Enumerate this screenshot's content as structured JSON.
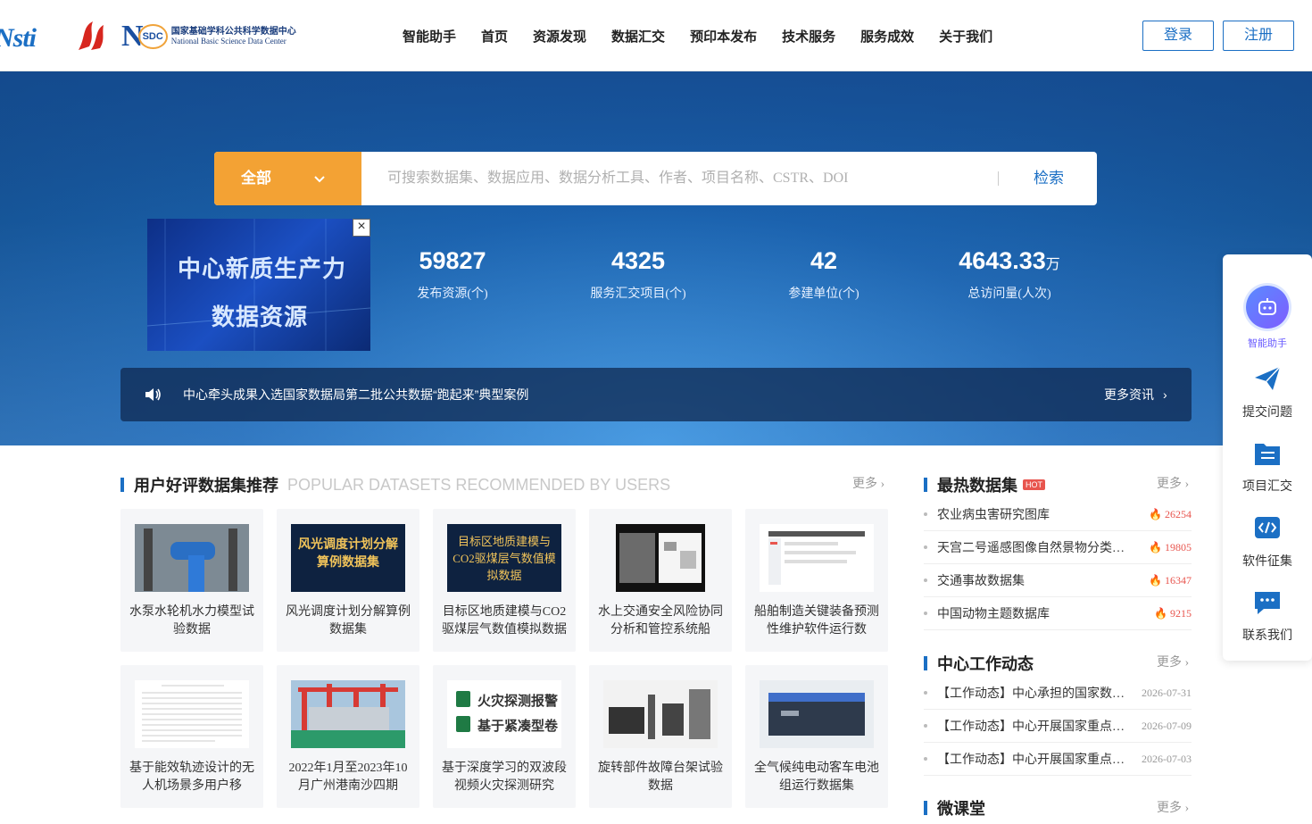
{
  "header": {
    "logo_nsti": "Nsti",
    "logo_n": "N",
    "logo_sdc": "SDC",
    "logo_cn": "国家基础学科公共科学数据中心",
    "logo_en": "National Basic Science Data Center",
    "nav": [
      "智能助手",
      "首页",
      "资源发现",
      "数据汇交",
      "预印本发布",
      "技术服务",
      "服务成效",
      "关于我们"
    ],
    "login": "登录",
    "register": "注册"
  },
  "search": {
    "category": "全部",
    "placeholder": "可搜索数据集、数据应用、数据分析工具、作者、项目名称、CSTR、DOI",
    "button": "检索"
  },
  "promo": {
    "line1": "中心新质生产力",
    "line2": "数据资源",
    "close": "×"
  },
  "stats": [
    {
      "num": "59827",
      "unit": "",
      "label": "发布资源(个)"
    },
    {
      "num": "4325",
      "unit": "",
      "label": "服务汇交项目(个)"
    },
    {
      "num": "42",
      "unit": "",
      "label": "参建单位(个)"
    },
    {
      "num": "4643.33",
      "unit": "万",
      "label": "总访问量(人次)"
    }
  ],
  "notice": {
    "message": "中心牵头成果入选国家数据局第二批公共数据“跑起来”典型案例",
    "more": "更多资讯"
  },
  "sidebar": {
    "ai": "智能助手",
    "items": [
      "提交问题",
      "项目汇交",
      "软件征集",
      "联系我们"
    ]
  },
  "datasets": {
    "title": "用户好评数据集推荐",
    "subtitle": "POPULAR DATASETS RECOMMENDED BY USERS",
    "more": "更多",
    "cards": [
      {
        "caption": "水泵水轮机水力模型试验数据",
        "thumb_text": ""
      },
      {
        "caption": "风光调度计划分解算例数据集",
        "thumb_text": "风光调度计划分解算例数据集"
      },
      {
        "caption": "目标区地质建模与CO2驱煤层气数值模拟数据",
        "thumb_text": "目标区地质建模与CO2驱煤层气数值模拟数据"
      },
      {
        "caption": "水上交通安全风险协同分析和管控系统船",
        "thumb_text": ""
      },
      {
        "caption": "船舶制造关键装备预测性维护软件运行数",
        "thumb_text": ""
      },
      {
        "caption": "基于能效轨迹设计的无人机场景多用户移",
        "thumb_text": ""
      },
      {
        "caption": "2022年1月至2023年10月广州港南沙四期",
        "thumb_text": ""
      },
      {
        "caption": "基于深度学习的双波段视频火灾探测研究",
        "thumb_text": "火灾探测报警 基于紧凑型卷"
      },
      {
        "caption": "旋转部件故障台架试验数据",
        "thumb_text": ""
      },
      {
        "caption": "全气候纯电动客车电池组运行数据集",
        "thumb_text": ""
      }
    ]
  },
  "hottest": {
    "title": "最热数据集",
    "badge": "HOT",
    "more": "更多",
    "rows": [
      {
        "title": "农业病虫害研究图库",
        "count": "26254"
      },
      {
        "title": "天宫二号遥感图像自然景物分类数据集",
        "count": "19805"
      },
      {
        "title": "交通事故数据集",
        "count": "16347"
      },
      {
        "title": "中国动物主题数据库",
        "count": "9215"
      }
    ]
  },
  "news": {
    "title": "中心工作动态",
    "more": "更多",
    "rows": [
      {
        "title": "【工作动态】中心承担的国家数据局项目",
        "date": "2026-07-31"
      },
      {
        "title": "【工作动态】中心开展国家重点研发计划",
        "date": "2026-07-09"
      },
      {
        "title": "【工作动态】中心开展国家重点研发计划",
        "date": "2026-07-03"
      }
    ]
  },
  "course": {
    "title": "微课堂",
    "more": "更多"
  },
  "colors": {
    "primary": "#1b6fc4",
    "accent": "#f3a234",
    "hot": "#e8554e"
  }
}
